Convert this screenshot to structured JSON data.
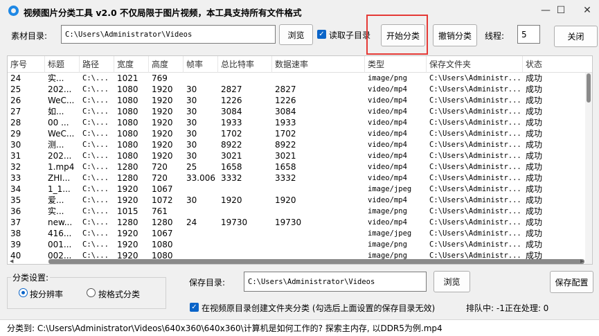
{
  "window": {
    "title": "视频图片分类工具 v2.0   不仅局限于图片视频，本工具支持所有文件格式",
    "minimize_glyph": "—",
    "maximize_glyph": "☐",
    "close_glyph": "✕"
  },
  "toolbar": {
    "source_label": "素材目录:",
    "source_path": "C:\\Users\\Administrator\\Videos",
    "browse_label": "浏览",
    "read_subdir_label": "读取子目录",
    "read_subdir_checked": true,
    "start_label": "开始分类",
    "undo_label": "撤销分类",
    "threads_label": "线程:",
    "threads_value": "5",
    "close_label": "关闭"
  },
  "table": {
    "columns": [
      "序号",
      "标题",
      "路径",
      "宽度",
      "高度",
      "帧率",
      "总比特率",
      "数据速率",
      "类型",
      "保存文件夹",
      "状态"
    ],
    "rows": [
      [
        "24",
        "实...",
        "C:\\...",
        "1021",
        "769",
        "",
        "",
        "",
        "image/png",
        "C:\\Users\\Administr...",
        "成功"
      ],
      [
        "25",
        "202...",
        "C:\\...",
        "1080",
        "1920",
        "30",
        "2827",
        "2827",
        "video/mp4",
        "C:\\Users\\Administr...",
        "成功"
      ],
      [
        "26",
        "WeC...",
        "C:\\...",
        "1080",
        "1920",
        "30",
        "1226",
        "1226",
        "video/mp4",
        "C:\\Users\\Administr...",
        "成功"
      ],
      [
        "27",
        "如...",
        "C:\\...",
        "1080",
        "1920",
        "30",
        "3084",
        "3084",
        "video/mp4",
        "C:\\Users\\Administr...",
        "成功"
      ],
      [
        "28",
        "00 ...",
        "C:\\...",
        "1080",
        "1920",
        "30",
        "1933",
        "1933",
        "video/mp4",
        "C:\\Users\\Administr...",
        "成功"
      ],
      [
        "29",
        "WeC...",
        "C:\\...",
        "1080",
        "1920",
        "30",
        "1702",
        "1702",
        "video/mp4",
        "C:\\Users\\Administr...",
        "成功"
      ],
      [
        "30",
        "测...",
        "C:\\...",
        "1080",
        "1920",
        "30",
        "8922",
        "8922",
        "video/mp4",
        "C:\\Users\\Administr...",
        "成功"
      ],
      [
        "31",
        "202...",
        "C:\\...",
        "1080",
        "1920",
        "30",
        "3021",
        "3021",
        "video/mp4",
        "C:\\Users\\Administr...",
        "成功"
      ],
      [
        "32",
        "1.mp4",
        "C:\\...",
        "1280",
        "720",
        "25",
        "1658",
        "1658",
        "video/mp4",
        "C:\\Users\\Administr...",
        "成功"
      ],
      [
        "33",
        "ZHI...",
        "C:\\...",
        "1280",
        "720",
        "33.006",
        "3332",
        "3332",
        "video/mp4",
        "C:\\Users\\Administr...",
        "成功"
      ],
      [
        "34",
        "1_1...",
        "C:\\...",
        "1920",
        "1067",
        "",
        "",
        "",
        "image/jpeg",
        "C:\\Users\\Administr...",
        "成功"
      ],
      [
        "35",
        "爱...",
        "C:\\...",
        "1920",
        "1072",
        "30",
        "1920",
        "1920",
        "video/mp4",
        "C:\\Users\\Administr...",
        "成功"
      ],
      [
        "36",
        "实...",
        "C:\\...",
        "1015",
        "761",
        "",
        "",
        "",
        "image/png",
        "C:\\Users\\Administr...",
        "成功"
      ],
      [
        "37",
        "new...",
        "C:\\...",
        "1280",
        "1280",
        "24",
        "19730",
        "19730",
        "video/mp4",
        "C:\\Users\\Administr...",
        "成功"
      ],
      [
        "38",
        "416...",
        "C:\\...",
        "1920",
        "1067",
        "",
        "",
        "",
        "image/jpeg",
        "C:\\Users\\Administr...",
        "成功"
      ],
      [
        "39",
        "001...",
        "C:\\...",
        "1920",
        "1080",
        "",
        "",
        "",
        "image/png",
        "C:\\Users\\Administr...",
        "成功"
      ],
      [
        "40",
        "002...",
        "C:\\...",
        "1920",
        "1080",
        "",
        "",
        "",
        "image/png",
        "C:\\Users\\Administr...",
        "成功"
      ]
    ]
  },
  "classify": {
    "group_label": "分类设置:",
    "by_resolution_label": "按分辨率",
    "by_resolution_selected": true,
    "by_format_label": "按格式分类",
    "save_dir_label": "保存目录:",
    "save_path": "C:\\Users\\Administrator\\Videos",
    "browse_label": "浏览",
    "save_config_label": "保存配置",
    "create_folder_label": "在视频原目录创建文件夹分类 (勾选后上面设置的保存目录无效)",
    "create_folder_checked": true,
    "queue_text": "排队中: -1正在处理: 0"
  },
  "status": {
    "text": "分类到: C:\\Users\\Administrator\\Videos\\640x360\\640x360\\计算机是如何工作的? 探索主内存, 以DDR5为例.mp4"
  }
}
